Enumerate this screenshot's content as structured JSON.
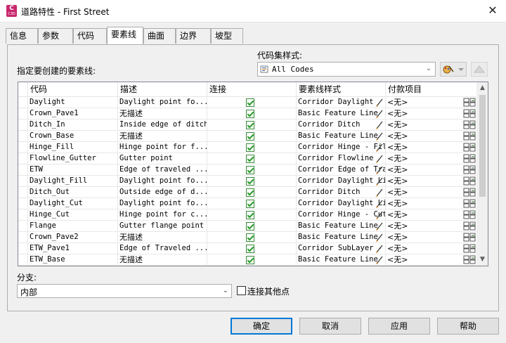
{
  "window": {
    "title": "道路特性 - First Street",
    "close_glyph": "✕",
    "app_icon_letter": "C",
    "app_icon_sub": "C3D"
  },
  "tabs": [
    "信息",
    "参数",
    "代码",
    "要素线",
    "曲面",
    "边界",
    "坡型"
  ],
  "active_tab": "要素线",
  "code_set_style": {
    "label": "代码集样式:",
    "value": "All Codes"
  },
  "specify_label": "指定要创建的要素线:",
  "table": {
    "headers": [
      "代码",
      "描述",
      "连接",
      "要素线样式",
      "付款项目"
    ],
    "rows": [
      {
        "code": "Daylight",
        "desc": "Daylight point fo...",
        "connect": true,
        "style": "Corridor Daylight",
        "pay": "<无>"
      },
      {
        "code": "Crown_Pave1",
        "desc": "无描述",
        "connect": true,
        "style": "Basic Feature Line",
        "pay": "<无>"
      },
      {
        "code": "Ditch_In",
        "desc": "Inside edge of ditch",
        "connect": true,
        "style": "Corridor Ditch",
        "pay": "<无>"
      },
      {
        "code": "Crown_Base",
        "desc": "无描述",
        "connect": true,
        "style": "Basic Feature Line",
        "pay": "<无>"
      },
      {
        "code": "Hinge_Fill",
        "desc": "Hinge point for f...",
        "connect": true,
        "style": "Corridor Hinge - Fill",
        "pay": "<无>"
      },
      {
        "code": "Flowline_Gutter",
        "desc": "Gutter point",
        "connect": true,
        "style": "Corridor Flowline",
        "pay": "<无>"
      },
      {
        "code": "ETW",
        "desc": "Edge of traveled ...",
        "connect": true,
        "style": "Corridor Edge of Travel",
        "pay": "<无>"
      },
      {
        "code": "Daylight_Fill",
        "desc": "Daylight point fo...",
        "connect": true,
        "style": "Corridor Daylight Line",
        "pay": "<无>"
      },
      {
        "code": "Ditch_Out",
        "desc": "Outside edge of d...",
        "connect": true,
        "style": "Corridor Ditch",
        "pay": "<无>"
      },
      {
        "code": "Daylight_Cut",
        "desc": "Daylight point fo...",
        "connect": true,
        "style": "Corridor Daylight Line",
        "pay": "<无>"
      },
      {
        "code": "Hinge_Cut",
        "desc": "Hinge point for c...",
        "connect": true,
        "style": "Corridor Hinge - Cut",
        "pay": "<无>"
      },
      {
        "code": "Flange",
        "desc": "Gutter flange point",
        "connect": true,
        "style": "Basic Feature Line",
        "pay": "<无>"
      },
      {
        "code": "Crown_Pave2",
        "desc": "无描述",
        "connect": true,
        "style": "Basic Feature Line",
        "pay": "<无>"
      },
      {
        "code": "ETW_Pave1",
        "desc": "Edge of Traveled ...",
        "connect": true,
        "style": "Corridor SubLayer - E",
        "pay": "<无>"
      },
      {
        "code": "ETW_Base",
        "desc": "无描述",
        "connect": true,
        "style": "Basic Feature Line",
        "pay": "<无>"
      }
    ]
  },
  "branch": {
    "label": "分支:",
    "value": "内部"
  },
  "connect_extra": {
    "label": "连接其他点",
    "checked": false
  },
  "buttons": {
    "ok": "确定",
    "cancel": "取消",
    "apply": "应用",
    "help": "帮助"
  },
  "colors": {
    "accent": "#0078d7",
    "check": "#2a9a2a",
    "app_icon": "#c8266d"
  }
}
